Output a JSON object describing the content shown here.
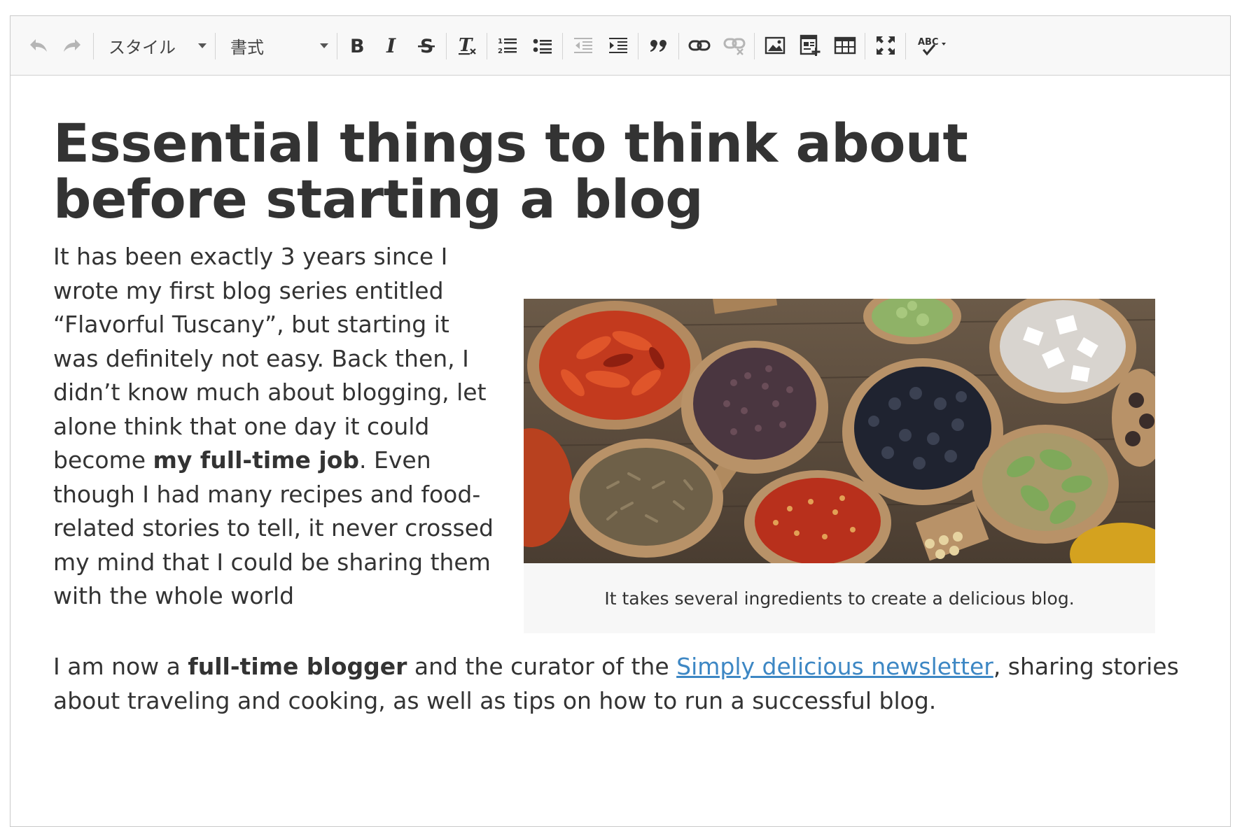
{
  "toolbar": {
    "undo_icon": "undo-icon",
    "redo_icon": "redo-icon",
    "styles_label": "スタイル",
    "format_label": "書式",
    "bold_icon": "bold-icon",
    "italic_icon": "italic-icon",
    "strike_icon": "strikethrough-icon",
    "clear_icon": "remove-format-icon",
    "ordered_list_icon": "numbered-list-icon",
    "bullet_list_icon": "bulleted-list-icon",
    "outdent_icon": "outdent-icon",
    "indent_icon": "indent-icon",
    "quote_icon": "blockquote-icon",
    "link_icon": "link-icon",
    "unlink_icon": "unlink-icon",
    "image_icon": "image-icon",
    "template_icon": "insert-template-icon",
    "table_icon": "table-icon",
    "maximize_icon": "maximize-icon",
    "spellcheck_label": "ABC"
  },
  "article": {
    "title": "Essential things to think about before starting a blog",
    "p1_before_bold": "It has been exactly 3 years since I wrote my first blog series entitled “Flavorful Tuscany”, but starting it was definitely not easy. Back then, I didn’t know much about blogging, let alone think that one day it could become ",
    "p1_bold": "my full-time job",
    "p1_after_bold": ". Even though I had many recipes and food-related stories to tell, it never crossed my mind that I could be sharing them with the whole world",
    "p2_before_bold": "I am now a ",
    "p2_bold": "full-time blogger",
    "p2_middle": " and the curator of the ",
    "p2_link": "Simply delicious newsletter",
    "p2_after_link": ", sharing stories about traveling and cooking, as well as tips on how to run a successful blog."
  },
  "figure": {
    "caption": "It takes several ingredients to create a delicious blog.",
    "image_alt": "Spices in wooden spoons"
  },
  "colors": {
    "link": "#3d87c4",
    "text": "#333333",
    "toolbar_bg": "#f8f8f8"
  }
}
